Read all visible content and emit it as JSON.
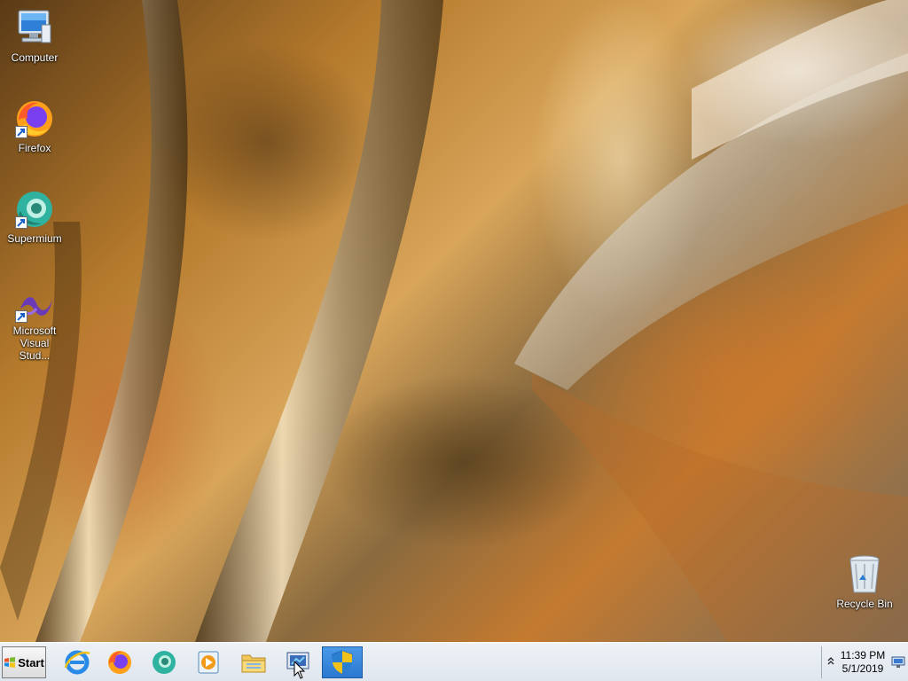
{
  "desktop": {
    "icons": [
      {
        "label": "Computer",
        "icon": "computer-icon"
      },
      {
        "label": "Firefox",
        "icon": "firefox-icon"
      },
      {
        "label": "Supermium",
        "icon": "supermium-icon"
      },
      {
        "label": "Microsoft Visual Stud...",
        "icon": "visual-studio-icon"
      },
      {
        "label": "Recycle Bin",
        "icon": "recycle-bin-icon"
      }
    ]
  },
  "taskbar": {
    "start_label": "Start",
    "pinned": [
      {
        "name": "internet-explorer",
        "icon": "internet-explorer-icon"
      },
      {
        "name": "firefox",
        "icon": "firefox-icon"
      },
      {
        "name": "supermium",
        "icon": "supermium-icon"
      },
      {
        "name": "media-player",
        "icon": "media-player-icon"
      },
      {
        "name": "file-explorer",
        "icon": "folder-icon"
      },
      {
        "name": "remote-desktop",
        "icon": "remote-desktop-icon"
      },
      {
        "name": "security",
        "icon": "shield-icon",
        "active": true
      }
    ],
    "tray": {
      "time": "11:39 PM",
      "date": "5/1/2019"
    }
  },
  "colors": {
    "taskbar_bg": "#e6ecf2",
    "active_item": "#3a88dc"
  }
}
